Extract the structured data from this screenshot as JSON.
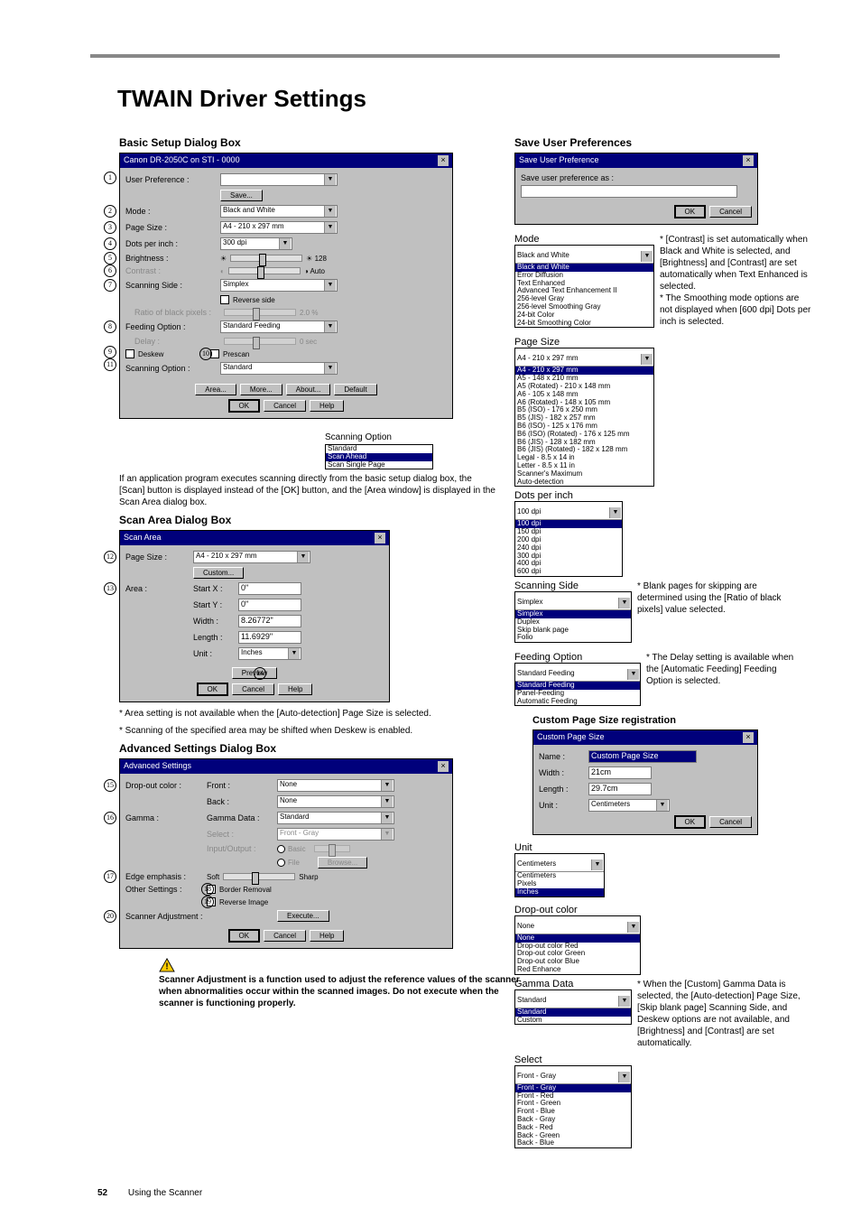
{
  "page_title": "TWAIN Driver Settings",
  "footer_text": "Using the Scanner",
  "page_number": "52",
  "headings": {
    "basic": "Basic Setup Dialog Box",
    "scanarea": "Scan Area Dialog Box",
    "advanced": "Advanced Settings Dialog Box",
    "save_pref": "Save User Preferences"
  },
  "basic_dialog": {
    "title": "Canon DR-2050C on STI - 0000",
    "rows": {
      "user_pref": "User Preference :",
      "save_btn": "Save...",
      "mode": "Mode :",
      "mode_val": "Black and White",
      "page_size": "Page Size :",
      "page_size_val": "A4 - 210 x 297 mm",
      "dpi": "Dots per inch :",
      "dpi_val": "300 dpi",
      "brightness": "Brightness :",
      "bright_val": "128",
      "contrast": "Contrast :",
      "auto": "Auto",
      "scan_side": "Scanning Side :",
      "scan_side_val": "Simplex",
      "reverse": "Reverse side",
      "ratio": "Ratio of black pixels :",
      "ratio_val": "2.0 %",
      "feed": "Feeding Option :",
      "feed_val": "Standard Feeding",
      "delay": "Delay :",
      "delay_val": "0 sec",
      "deskew": "Deskew",
      "deskew_val": "10",
      "prescan": "Prescan",
      "scan_opt": "Scanning Option :",
      "scan_opt_val": "Standard",
      "btns": {
        "area": "Area...",
        "more": "More...",
        "about": "About...",
        "default": "Default",
        "ok": "OK",
        "cancel": "Cancel",
        "help": "Help"
      }
    }
  },
  "scan_option_box": {
    "title": "Scanning Option",
    "items": [
      "Standard",
      "Scan Ahead",
      "Scan Single Page"
    ],
    "hl": 0
  },
  "basic_note": "If an application program executes scanning directly from the basic setup dialog box, the [Scan] button is displayed instead of the [OK] button, and the [Area window] is displayed in the Scan Area dialog box.",
  "scan_area": {
    "title": "Scan Area",
    "page_size": "Page Size :",
    "page_size_val": "A4 - 210 x 297 mm",
    "custom": "Custom...",
    "area": "Area :",
    "startx": "Start X :",
    "startx_v": "0\"",
    "starty": "Start Y :",
    "starty_v": "0\"",
    "width": "Width :",
    "width_v": "8.26772\"",
    "length": "Length :",
    "length_v": "11.6929\"",
    "unit": "Unit :",
    "unit_v": "Inches",
    "preview": "Preview",
    "btns": {
      "ok": "OK",
      "cancel": "Cancel",
      "help": "Help"
    }
  },
  "area_notes": [
    "* Area setting is not available when the [Auto-detection] Page Size is selected.",
    "* Scanning of the specified area may be shifted when Deskew is enabled."
  ],
  "advanced": {
    "title": "Advanced Settings",
    "dropout": "Drop-out color :",
    "front": "Front :",
    "back": "Back :",
    "none": "None",
    "gamma": "Gamma :",
    "gamma_data": "Gamma Data :",
    "std": "Standard",
    "select": "Select :",
    "front_gray": "Front - Gray",
    "input_output": "Input/Output :",
    "basic_r": "Basic",
    "file_r": "File",
    "browse": "Browse...",
    "edge": "Edge emphasis :",
    "soft": "Soft",
    "sharp": "Sharp",
    "other": "Other Settings :",
    "border": "Border Removal",
    "reverse": "Reverse Image",
    "scanner_adj": "Scanner Adjustment :",
    "execute": "Execute...",
    "btns": {
      "ok": "OK",
      "cancel": "Cancel",
      "help": "Help"
    }
  },
  "warning": "Scanner Adjustment is a function used to adjust the reference values of the scanner when abnormalities occur within the scanned images. Do not execute when the scanner is functioning properly.",
  "right": {
    "save_pref_dialog": {
      "title": "Save User Preference",
      "lbl": "Save user preference as :",
      "ok": "OK",
      "cancel": "Cancel"
    },
    "mode": {
      "label": "Mode",
      "items": [
        "Black and White",
        "Error Diffusion",
        "Text Enhanced",
        "Advanced Text Enhancement II",
        "256-level Gray",
        "256-level Smoothing Gray",
        "24-bit Color",
        "24-bit Smoothing Color"
      ],
      "hl": 0,
      "note": "* [Contrast] is set automatically when Black and White is selected, and [Brightness] and [Contrast] are set automatically when Text Enhanced is selected.\n* The Smoothing mode options are not displayed when [600 dpi] Dots per inch is selected."
    },
    "page_size": {
      "label": "Page Size",
      "items": [
        "A4 - 210 x 297 mm",
        "A5 - 148 x 210 mm",
        "A5 (Rotated) - 210 x 148 mm",
        "A6 - 105 x 148 mm",
        "A6 (Rotated) - 148 x 105 mm",
        "B5 (ISO) - 176 x 250 mm",
        "B5 (JIS) - 182 x 257 mm",
        "B6 (ISO) - 125 x 176 mm",
        "B6 (ISO) (Rotated) - 176 x 125 mm",
        "B6 (JIS) - 128 x 182 mm",
        "B6 (JIS) (Rotated) - 182 x 128 mm",
        "Legal - 8.5 x 14 in",
        "Letter - 8.5 x 11 in",
        "Scanner's Maximum",
        "Auto-detection"
      ],
      "hl": 0
    },
    "dpi": {
      "label": "Dots per inch",
      "items": [
        "100 dpi",
        "150 dpi",
        "200 dpi",
        "240 dpi",
        "300 dpi",
        "400 dpi",
        "600 dpi"
      ],
      "hl": 0
    },
    "scan_side": {
      "label": "Scanning Side",
      "items": [
        "Simplex",
        "Duplex",
        "Skip blank page",
        "Folio"
      ],
      "hl": 0,
      "note": "* Blank pages for skipping are determined using the [Ratio of black pixels] value selected."
    },
    "feed": {
      "label": "Feeding Option",
      "items": [
        "Standard Feeding",
        "Panel-Feeding",
        "Automatic Feeding"
      ],
      "hl": 0,
      "note": "* The Delay setting is available when the [Automatic Feeding] Feeding Option is selected."
    },
    "custom_page": {
      "title": "Custom Page Size registration",
      "dlg_title": "Custom Page Size",
      "name": "Name :",
      "name_v": "Custom Page Size",
      "width": "Width :",
      "width_v": "21cm",
      "length": "Length :",
      "length_v": "29.7cm",
      "unit": "Unit :",
      "unit_v": "Centimeters",
      "ok": "OK",
      "cancel": "Cancel"
    },
    "unit": {
      "label": "Unit",
      "items": [
        "Centimeters",
        "Pixels",
        "Inches"
      ],
      "hl": 2
    },
    "dropout": {
      "label": "Drop-out color",
      "items": [
        "None",
        "Drop-out color Red",
        "Drop-out color Green",
        "Drop-out color Blue",
        "Red Enhance"
      ],
      "hl": 0
    },
    "gamma_data": {
      "label": "Gamma Data",
      "items": [
        "Standard",
        "Custom"
      ],
      "hl": 0,
      "note": "* When the [Custom] Gamma Data is selected, the [Auto-detection] Page Size, [Skip blank page] Scanning Side, and Deskew options are not available, and [Brightness] and [Contrast] are set automatically."
    },
    "select": {
      "label": "Select",
      "items": [
        "Front - Gray",
        "Front - Red",
        "Front - Green",
        "Front - Blue",
        "Back - Gray",
        "Back - Red",
        "Back - Green",
        "Back - Blue"
      ],
      "hl": 0
    }
  },
  "circled": [
    "1",
    "2",
    "3",
    "4",
    "5",
    "6",
    "7",
    "8",
    "9",
    "11",
    "10",
    "12",
    "13",
    "14",
    "15",
    "16",
    "17",
    "18",
    "19",
    "20"
  ]
}
